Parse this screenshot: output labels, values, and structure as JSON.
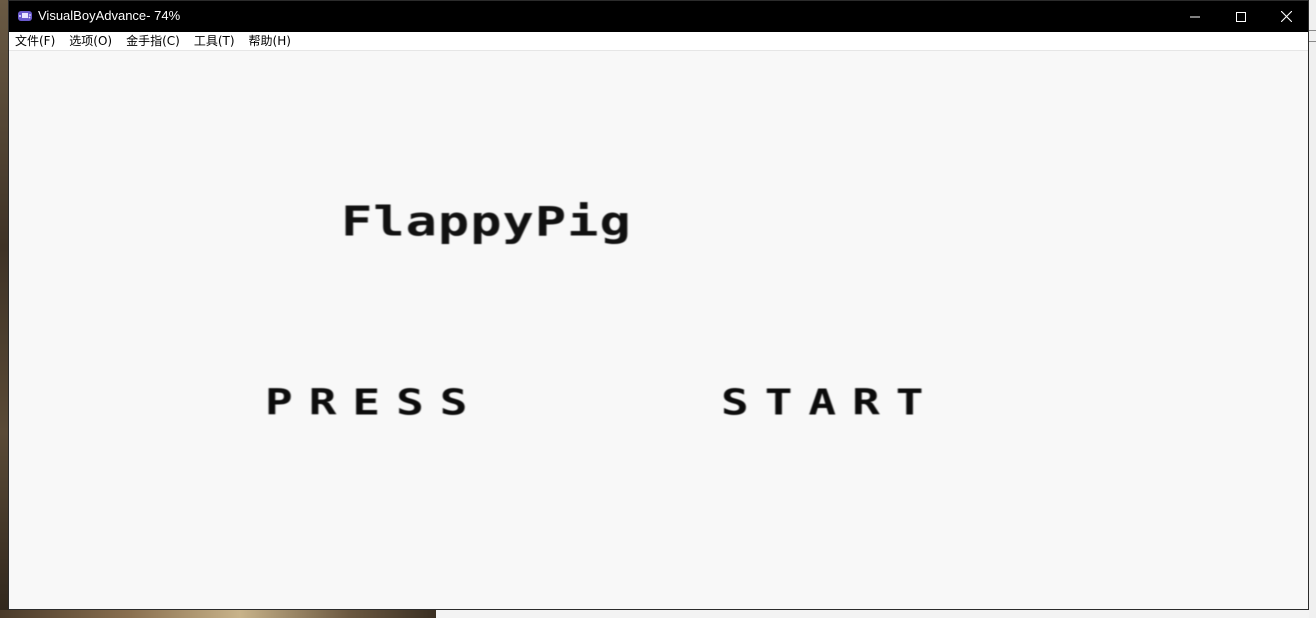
{
  "window": {
    "title": "VisualBoyAdvance- 74%",
    "icon": "gameboy-advance-icon",
    "controls": {
      "minimize": "minimize-icon",
      "maximize": "maximize-icon",
      "close": "close-icon"
    }
  },
  "menubar": {
    "items": [
      {
        "label": "文件(F)"
      },
      {
        "label": "选项(O)"
      },
      {
        "label": "金手指(C)"
      },
      {
        "label": "工具(T)"
      },
      {
        "label": "帮助(H)"
      }
    ]
  },
  "game": {
    "title": "FlappyPig",
    "prompt_left": "PRESS",
    "prompt_right": "START"
  },
  "colors": {
    "titlebar": "#000000",
    "screen_bg": "#f8f8f8",
    "text": "#111111"
  }
}
